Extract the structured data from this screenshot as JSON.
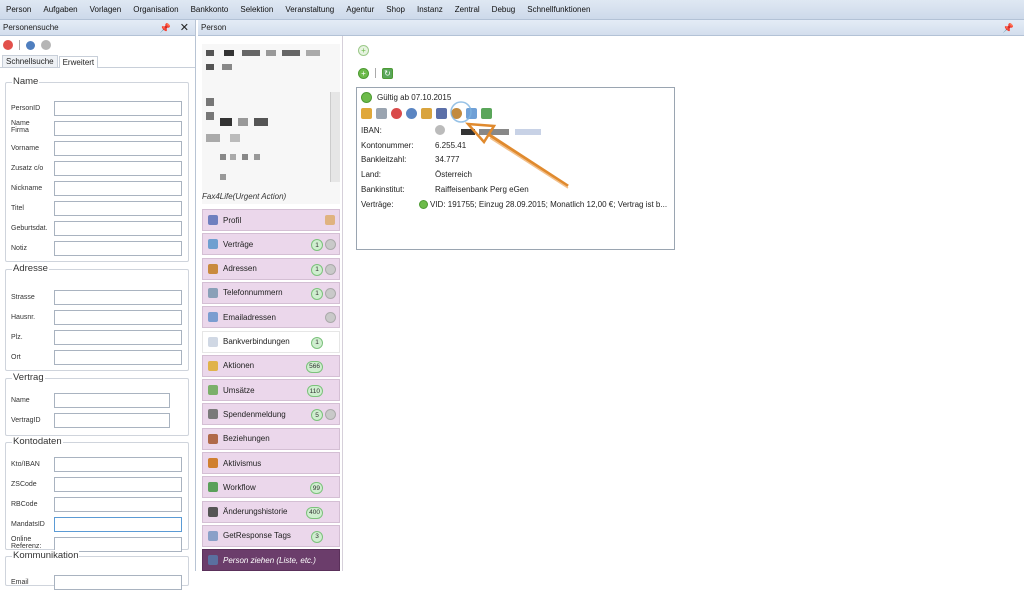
{
  "menu": [
    "Person",
    "Aufgaben",
    "Vorlagen",
    "Organisation",
    "Bankkonto",
    "Selektion",
    "Veranstaltung",
    "Agentur",
    "Shop",
    "Instanz",
    "Zentral",
    "Debug",
    "Schnellfunktionen"
  ],
  "left_panel": {
    "title": "Personensuche",
    "tabs": [
      "Schnellsuche",
      "Erweitert"
    ],
    "sections": {
      "name": {
        "legend": "Name",
        "fields": [
          "PersonID",
          "Name\nFirma",
          "Vorname",
          "Zusatz c/o",
          "Nickname",
          "Titel",
          "Geburtsdat.",
          "Notiz"
        ]
      },
      "adresse": {
        "legend": "Adresse",
        "fields": [
          "Strasse",
          "Hausnr.",
          "Plz.",
          "Ort"
        ]
      },
      "vertrag": {
        "legend": "Vertrag",
        "fields": [
          "Name",
          "VertragID"
        ]
      },
      "kontodaten": {
        "legend": "Kontodaten",
        "fields": [
          "Kto/IBAN",
          "ZSCode",
          "RBCode",
          "MandatsID",
          "Online\nReferenz:"
        ]
      },
      "kommunikation": {
        "legend": "Kommunikation",
        "fields": [
          "Email"
        ]
      }
    }
  },
  "main": {
    "title": "Person",
    "urgent": "Fax4Life(Urgent Action)",
    "nav": [
      {
        "label": "Profil",
        "badge": ""
      },
      {
        "label": "Verträge",
        "badge": "1"
      },
      {
        "label": "Adressen",
        "badge": "1"
      },
      {
        "label": "Telefonnummern",
        "badge": "1"
      },
      {
        "label": "Emailadressen",
        "badge": ""
      },
      {
        "label": "Bankverbindungen",
        "badge": "1"
      },
      {
        "label": "Aktionen",
        "badge": "566"
      },
      {
        "label": "Umsätze",
        "badge": "110"
      },
      {
        "label": "Spendenmeldung",
        "badge": "5"
      },
      {
        "label": "Beziehungen",
        "badge": ""
      },
      {
        "label": "Aktivismus",
        "badge": ""
      },
      {
        "label": "Workflow",
        "badge": "99"
      },
      {
        "label": "Änderungshistorie",
        "badge": "400"
      },
      {
        "label": "GetResponse Tags",
        "badge": "3"
      },
      {
        "label": "Person ziehen (Liste, etc.)",
        "badge": ""
      }
    ],
    "card": {
      "valid": "Gültig ab 07.10.2015",
      "rows": [
        {
          "label": "IBAN:",
          "value": ""
        },
        {
          "label": "Kontonummer:",
          "value": "6.255.41"
        },
        {
          "label": "Bankleitzahl:",
          "value": "34.777"
        },
        {
          "label": "Land:",
          "value": "Österreich"
        },
        {
          "label": "Bankinstitut:",
          "value": "Raiffeisenbank Perg eGen"
        },
        {
          "label": "Verträge:",
          "value": "VID: 191755; Einzug 28.09.2015; Monatlich 12,00 €; Vertrag ist b..."
        }
      ]
    }
  },
  "colors": {
    "accent_green": "#6dbb4a",
    "nav_bg": "#ebd7eb",
    "nav_dark": "#6b3d6b",
    "arrow": "#e08a2e"
  }
}
